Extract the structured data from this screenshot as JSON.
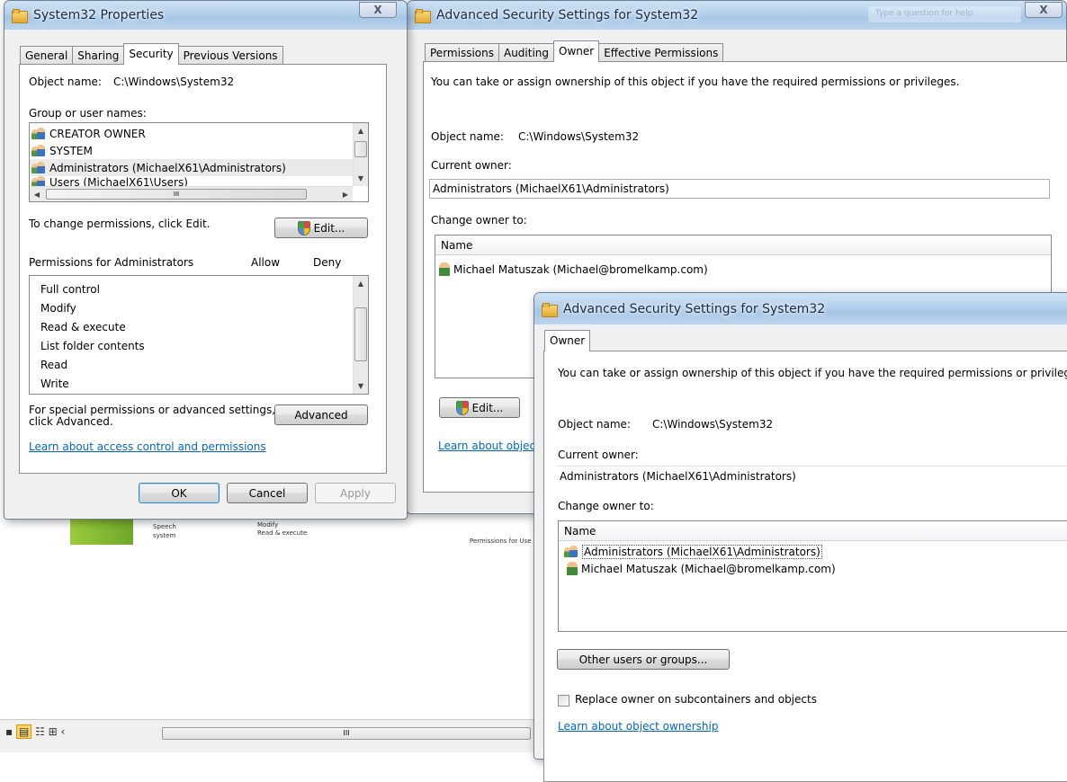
{
  "colors": {
    "link": "#0066cc",
    "title_glass": "#b6d1ec",
    "selection": "#eaeaea"
  },
  "background": {
    "items": [
      "Speech",
      "system"
    ],
    "perm_preview": [
      "Modify",
      "Read & execute"
    ],
    "side_label": "Permissions for Use"
  },
  "props": {
    "title": "System32 Properties",
    "close": "X",
    "tabs": [
      "General",
      "Sharing",
      "Security",
      "Previous Versions"
    ],
    "object_name_label": "Object name:",
    "object_name_value": "C:\\Windows\\System32",
    "group_label": "Group or user names:",
    "groups": [
      "CREATOR OWNER",
      "SYSTEM",
      "Administrators (MichaelX61\\Administrators)",
      "Users (MichaelX61\\Users)"
    ],
    "hscroll_grip": "III",
    "change_text": "To change permissions, click Edit.",
    "edit_button": "Edit...",
    "perms_label": "Permissions for Administrators",
    "allow": "Allow",
    "deny": "Deny",
    "permissions": [
      "Full control",
      "Modify",
      "Read & execute",
      "List folder contents",
      "Read",
      "Write"
    ],
    "special_text_1": "For special permissions or advanced settings,",
    "special_text_2": "click Advanced.",
    "advanced_button": "Advanced",
    "learn_link": "Learn about access control and permissions",
    "ok": "OK",
    "cancel": "Cancel",
    "apply": "Apply"
  },
  "adv1": {
    "title": "Advanced Security Settings for System32",
    "close": "X",
    "search_placeholder": "Type a question for help",
    "tabs": [
      "Permissions",
      "Auditing",
      "Owner",
      "Effective Permissions"
    ],
    "intro": "You can take or assign ownership of this object if you have the required permissions or privileges.",
    "object_name_label": "Object name:",
    "object_name_value": "C:\\Windows\\System32",
    "current_owner_label": "Current owner:",
    "current_owner_value": "Administrators (MichaelX61\\Administrators)",
    "change_owner_label": "Change owner to:",
    "name_header": "Name",
    "owners": [
      "Michael Matuszak (Michael@bromelkamp.com)"
    ],
    "edit_button": "Edit...",
    "learn_link": "Learn about objec"
  },
  "adv2": {
    "title": "Advanced Security Settings for System32",
    "tabs": [
      "Owner"
    ],
    "intro": "You can take or assign ownership of this object if you have the required permissions or privileges.",
    "object_name_label": "Object name:",
    "object_name_value": "C:\\Windows\\System32",
    "current_owner_label": "Current owner:",
    "current_owner_value": "Administrators (MichaelX61\\Administrators)",
    "change_owner_label": "Change owner to:",
    "name_header": "Name",
    "owners": [
      "Administrators (MichaelX61\\Administrators)",
      "Michael Matuszak (Michael@bromelkamp.com)"
    ],
    "other_users_button": "Other users or groups...",
    "replace_checkbox": "Replace owner on subcontainers and objects",
    "learn_link": "Learn about object ownership"
  },
  "statusbar": {
    "grip": "III"
  }
}
